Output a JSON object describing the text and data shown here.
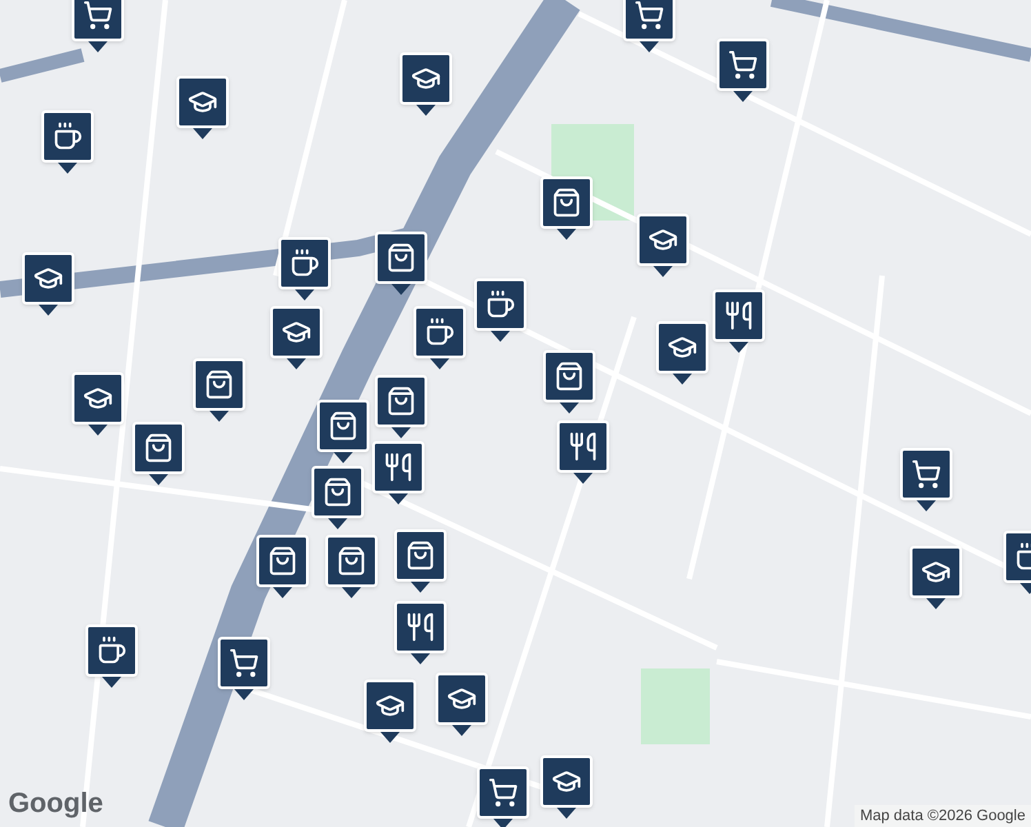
{
  "map": {
    "pins": [
      {
        "kind": "cart"
      },
      {
        "kind": "school"
      },
      {
        "kind": "school"
      },
      {
        "kind": "coffee"
      },
      {
        "kind": "cart"
      },
      {
        "kind": "cart"
      },
      {
        "kind": "bag"
      },
      {
        "kind": "school"
      },
      {
        "kind": "coffee"
      },
      {
        "kind": "bag"
      },
      {
        "kind": "school"
      },
      {
        "kind": "school"
      },
      {
        "kind": "coffee"
      },
      {
        "kind": "coffee"
      },
      {
        "kind": "restaurant"
      },
      {
        "kind": "school"
      },
      {
        "kind": "bag"
      },
      {
        "kind": "school"
      },
      {
        "kind": "bag"
      },
      {
        "kind": "bag"
      },
      {
        "kind": "bag"
      },
      {
        "kind": "bag"
      },
      {
        "kind": "bag"
      },
      {
        "kind": "restaurant"
      },
      {
        "kind": "restaurant"
      },
      {
        "kind": "cart"
      },
      {
        "kind": "bag"
      },
      {
        "kind": "bag"
      },
      {
        "kind": "bag"
      },
      {
        "kind": "school"
      },
      {
        "kind": "coffee"
      },
      {
        "kind": "restaurant"
      },
      {
        "kind": "coffee"
      },
      {
        "kind": "cart"
      },
      {
        "kind": "school"
      },
      {
        "kind": "school"
      },
      {
        "kind": "school"
      },
      {
        "kind": "cart"
      }
    ]
  },
  "attribution": {
    "logo": "Google",
    "text": "Map data ©2026 Google"
  }
}
